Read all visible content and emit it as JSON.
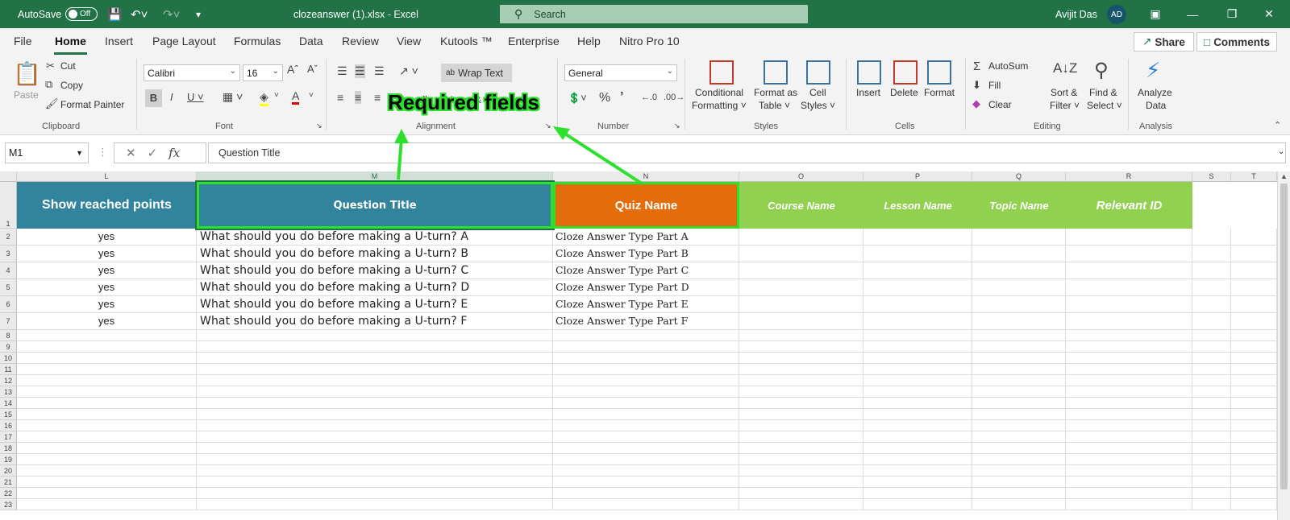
{
  "titlebar": {
    "autosave_label": "AutoSave",
    "autosave_state": "Off",
    "doc_title": "clozeanswer (1).xlsx  -  Excel",
    "search_placeholder": "Search",
    "user_name": "Avijit Das",
    "user_initials": "AD"
  },
  "menu": {
    "tabs": [
      "File",
      "Home",
      "Insert",
      "Page Layout",
      "Formulas",
      "Data",
      "Review",
      "View",
      "Kutools ™",
      "Enterprise",
      "Help",
      "Nitro Pro 10"
    ],
    "active": "Home",
    "share_label": "Share",
    "comments_label": "Comments"
  },
  "ribbon": {
    "clipboard": {
      "paste": "Paste",
      "cut": "Cut",
      "copy": "Copy",
      "format_painter": "Format Painter",
      "group": "Clipboard"
    },
    "font": {
      "name": "Calibri",
      "size": "16",
      "group": "Font"
    },
    "alignment": {
      "wrap_text": "Wrap Text",
      "merge_center": "Merge & Center",
      "group": "Alignment"
    },
    "number": {
      "format": "General",
      "group": "Number"
    },
    "styles": {
      "conditional": "Conditional",
      "formatting": "Formatting",
      "format_as": "Format as",
      "table": "Table",
      "cell": "Cell",
      "cell_styles": "Styles",
      "group": "Styles"
    },
    "cells": {
      "insert": "Insert",
      "delete": "Delete",
      "format": "Format",
      "group": "Cells"
    },
    "editing": {
      "autosum": "AutoSum",
      "fill": "Fill",
      "clear": "Clear",
      "sort": "Sort &",
      "filter": "Filter",
      "find": "Find &",
      "select": "Select",
      "group": "Editing"
    },
    "analysis": {
      "analyze": "Analyze",
      "data": "Data",
      "group": "Analysis"
    }
  },
  "formula_bar": {
    "name_box": "M1",
    "fx": "fx",
    "content": "Question Title"
  },
  "columns": [
    "L",
    "M",
    "N",
    "O",
    "P",
    "Q",
    "R",
    "S",
    "T"
  ],
  "headers": {
    "L": "Show reached points",
    "M": "Question Title",
    "N": "Quiz Name",
    "O": "Course Name",
    "P": "Lesson Name",
    "Q": "Topic Name",
    "R": "Relevant ID"
  },
  "rows": [
    {
      "L": "yes",
      "M": "What should you do before making a U-turn? A",
      "N": "Cloze Answer Type Part A"
    },
    {
      "L": "yes",
      "M": "What should you do before making a U-turn? B",
      "N": "Cloze Answer Type  Part B"
    },
    {
      "L": "yes",
      "M": "What should you do before making a U-turn? C",
      "N": "Cloze Answer Type Part C"
    },
    {
      "L": "yes",
      "M": "What should you do before making a U-turn? D",
      "N": "Cloze Answer Type Part D"
    },
    {
      "L": "yes",
      "M": "What should you do before making a U-turn? E",
      "N": "Cloze Answer Type Part E"
    },
    {
      "L": "yes",
      "M": "What should you do before making a U-turn? F",
      "N": "Cloze Answer Type Part F"
    }
  ],
  "row_numbers": [
    "1",
    "2",
    "3",
    "4",
    "5",
    "6",
    "7",
    "8",
    "9",
    "10",
    "11",
    "12",
    "13",
    "14",
    "15",
    "16",
    "17",
    "18",
    "19",
    "20",
    "21",
    "22",
    "23"
  ],
  "annotation": "Required fields",
  "colors": {
    "excel_green": "#217346",
    "teal_header": "#31849b",
    "orange_header": "#e46c0a",
    "lime_header": "#92d050",
    "annotation_green": "#2de02d"
  }
}
